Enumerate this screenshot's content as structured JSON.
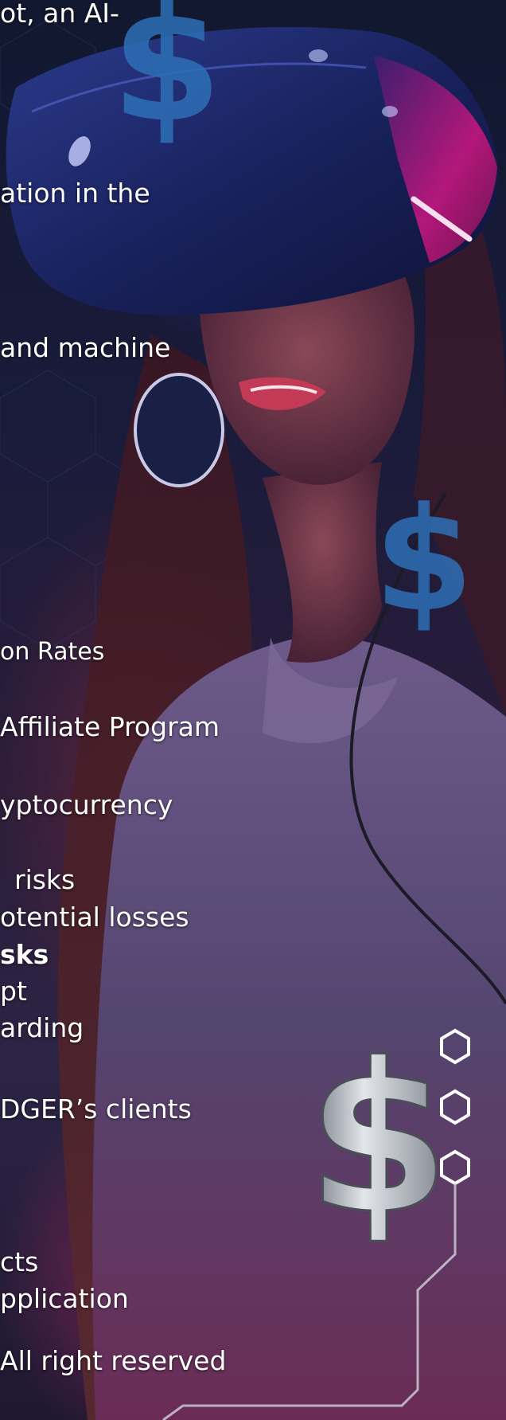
{
  "colors": {
    "text": "#ffffff",
    "background_dark": "#0b1022",
    "headset_blue": "#1c2565",
    "headset_pink": "#c2187a",
    "dollar_blue": "#2d6fb6",
    "dollar_silver": "#b8bcc4"
  },
  "icons": [
    "dollar-icon",
    "hexagon-icon",
    "circuit-line"
  ],
  "lines": [
    "ot, an AI-",
    "ation in the",
    "and machine",
    "on Rates",
    "Affiliate Program",
    "yptocurrency",
    "risks",
    "otential losses",
    "sks",
    "pt",
    "arding",
    "DGER’s clients",
    "cts",
    "pplication",
    "All right reserved"
  ]
}
